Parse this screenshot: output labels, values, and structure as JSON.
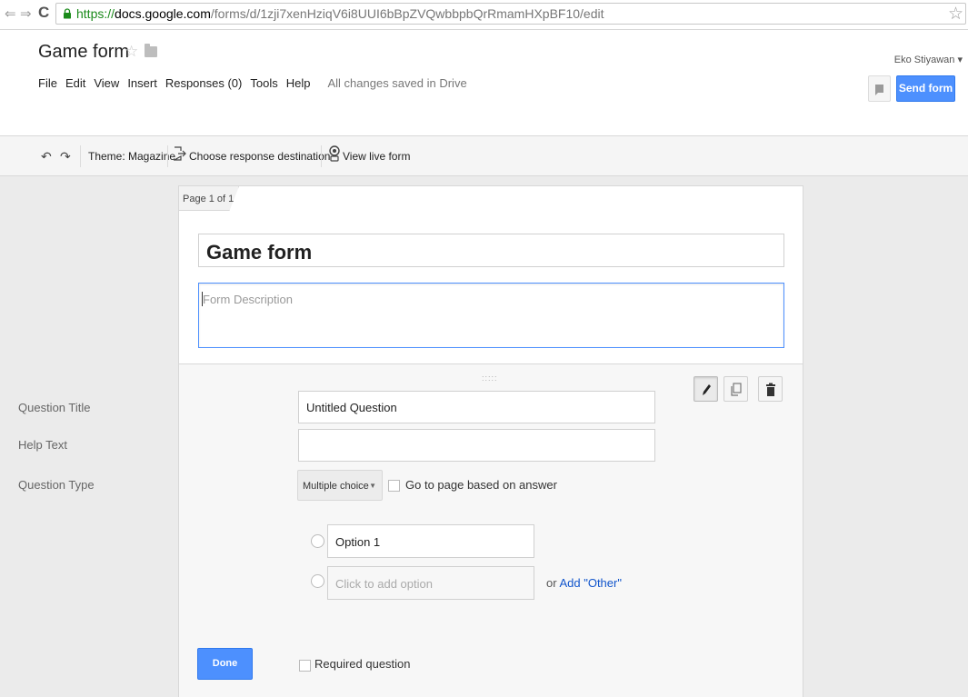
{
  "browser": {
    "back_glyph": "⇐",
    "forward_glyph": "⇒",
    "reload_glyph": "C",
    "url_scheme": "https://",
    "url_domain": "docs.google.com",
    "url_path": "/forms/d/1zji7xenHziqV6i8UUI6bBpZVQwbbpbQrRmamHXpBF10/edit",
    "bookmark_glyph": "☆"
  },
  "header": {
    "doc_title": "Game form",
    "star_glyph": "☆",
    "user_name": "Eko Stiyawan ▾",
    "send_button": "Send form",
    "menu": [
      "File",
      "Edit",
      "View",
      "Insert",
      "Responses (0)",
      "Tools",
      "Help"
    ],
    "saved_status": "All changes saved in Drive"
  },
  "toolbar": {
    "undo_glyph": "↶",
    "redo_glyph": "↷",
    "theme_label": "Theme: Magazine",
    "destination_label": "Choose response destination",
    "live_form_label": "View live form"
  },
  "form": {
    "page_indicator": "Page 1 of 1",
    "title": "Game form",
    "description_placeholder": "Form Description"
  },
  "question": {
    "drag_handle": ":::::",
    "title_label": "Question Title",
    "title_value": "Untitled Question",
    "help_label": "Help Text",
    "help_value": "",
    "type_label": "Question Type",
    "type_value": "Multiple choice",
    "type_arrow": "▼",
    "goto_page_label": "Go to page based on answer",
    "options": [
      {
        "value": "Option 1"
      }
    ],
    "add_option_placeholder": "Click to add option",
    "or_text": "or",
    "add_other_link": "Add \"Other\"",
    "done_button": "Done",
    "required_label": "Required question"
  },
  "colors": {
    "accent_blue": "#4d90fe",
    "link_blue": "#1155cc",
    "secure_green": "#1a8a1a"
  }
}
